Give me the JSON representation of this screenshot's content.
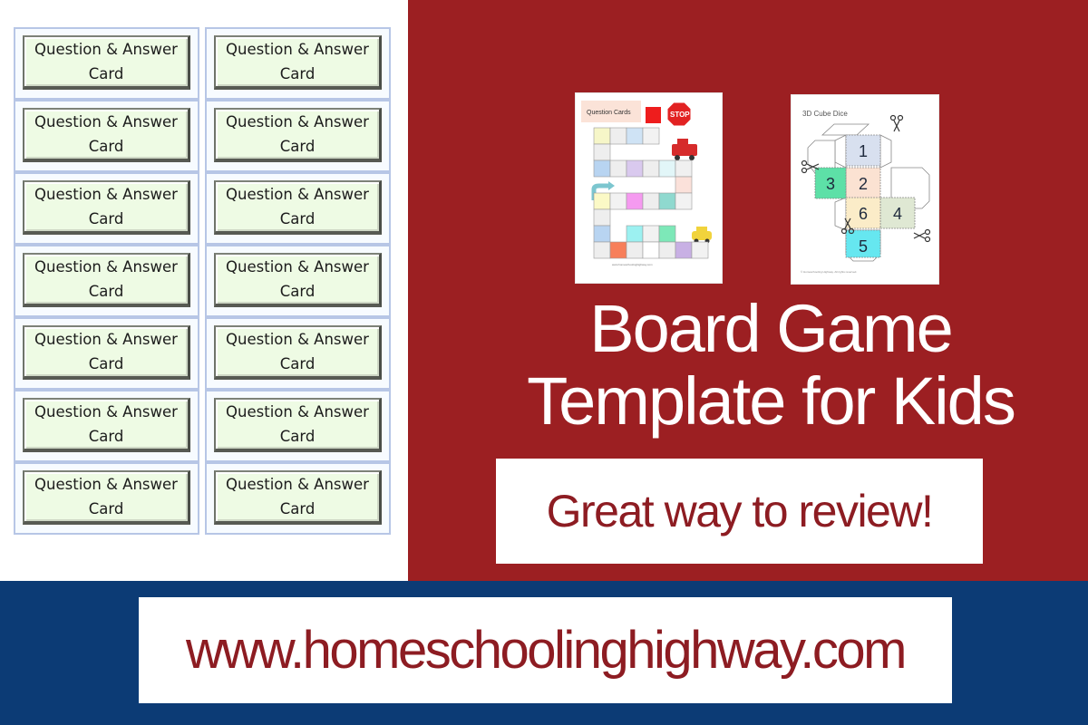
{
  "colors": {
    "red_panel": "#9c1f22",
    "blue_band": "#0c3b75",
    "text_red": "#8d1c22",
    "card_fill": "#eefbe4",
    "card_cell_border": "#b7c6e6"
  },
  "card_grid": {
    "cards": [
      {
        "line1": "Question & Answer",
        "line2": "Card"
      },
      {
        "line1": "Question & Answer",
        "line2": "Card"
      },
      {
        "line1": "Question & Answer",
        "line2": "Card"
      },
      {
        "line1": "Question & Answer",
        "line2": "Card"
      },
      {
        "line1": "Question & Answer",
        "line2": "Card"
      },
      {
        "line1": "Question & Answer",
        "line2": "Card"
      },
      {
        "line1": "Question & Answer",
        "line2": "Card"
      },
      {
        "line1": "Question & Answer",
        "line2": "Card"
      },
      {
        "line1": "Question & Answer",
        "line2": "Card"
      },
      {
        "line1": "Question & Answer",
        "line2": "Card"
      },
      {
        "line1": "Question & Answer",
        "line2": "Card"
      },
      {
        "line1": "Question & Answer",
        "line2": "Card"
      },
      {
        "line1": "Question & Answer",
        "line2": "Card"
      },
      {
        "line1": "Question & Answer",
        "line2": "Card"
      }
    ]
  },
  "board_thumbnail": {
    "heading": "Question Cards",
    "stop_sign": "STOP",
    "icons": [
      "stop-sign-icon",
      "fire-truck-icon",
      "taxi-icon",
      "turn-arrow-icon"
    ]
  },
  "dice_thumbnail": {
    "heading": "3D Cube Dice",
    "faces": [
      "1",
      "2",
      "3",
      "4",
      "5",
      "6"
    ],
    "icons": [
      "scissors-icon"
    ]
  },
  "title": {
    "line1": "Board Game",
    "line2": "Template for Kids"
  },
  "tagline": "Great way to review!",
  "url": "www.homeschoolinghighway.com"
}
